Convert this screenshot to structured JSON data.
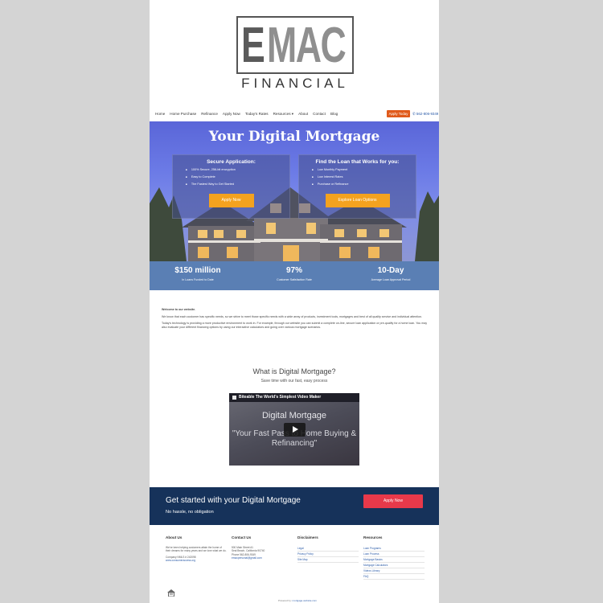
{
  "logo": {
    "e": "E",
    "mac": "MAC",
    "financial": "FINANCIAL"
  },
  "nav": {
    "items": [
      "Home",
      "Home Purchase",
      "Refinance",
      "Apply Now",
      "Today's Rates",
      "Resources ▾",
      "About",
      "Contact",
      "Blog"
    ],
    "apply_today": "Apply Today",
    "phone": "562-806-9349"
  },
  "hero": {
    "title": "Your Digital Mortgage",
    "left_panel": {
      "title": "Secure Application:",
      "items": [
        "100% Secure, 256-bit encryption",
        "Easy to Complete",
        "The Fastest Way to Get Started"
      ],
      "button": "Apply Now"
    },
    "right_panel": {
      "title": "Find the Loan that Works for you:",
      "items": [
        "Low Monthly Payment",
        "Low Interest Rates",
        "Purchase or Refinance"
      ],
      "button": "Explore Loan Options"
    }
  },
  "stats": [
    {
      "value": "$150 million",
      "label": "In Loans Funded to Date"
    },
    {
      "value": "97%",
      "label": "Customer Satisfaction Rate"
    },
    {
      "value": "10-Day",
      "label": "Average Loan Approval Period"
    }
  ],
  "welcome": {
    "title": "Welcome to our website.",
    "p1": "We know that each customer has specific needs, so we strive to meet those specific needs with a wide array of products, investment tools, mortgages and best of all quality service and individual attention.",
    "p2": "Today's technology is providing a more productive environment to work in. For example, through our website you can submit a complete on-line, secure loan application or pre-qualify for a home loan. You may also evaluate your different financing options by using our interactive calculators and going over various mortgage scenarios."
  },
  "what": {
    "title": "What is Digital Mortgage?",
    "subtitle": "Save time with our fast, easy process",
    "video": {
      "brand": "Biteable",
      "brand_text": "The World's Simplest Video Maker",
      "title": "Digital Mortgage",
      "subtitle": "\"Your Fast Pass to Home Buying & Refinancing\""
    }
  },
  "cta": {
    "title": "Get started with your Digital Mortgage",
    "subtitle": "No hassle, no obligation",
    "button": "Apply Now"
  },
  "footer": {
    "about": {
      "title": "About Us",
      "text": "We've been helping customers attain the home of their dreams for many years and we love what we do.",
      "nmls": "Company NMLS # 242098",
      "link": "www.consumeraccess.org"
    },
    "contact": {
      "title": "Contact Us",
      "address1": "500 Main Street #1",
      "address2": "Seal Beach, California 90740",
      "phone": "Phone 562-806-9349",
      "email": "emacpersonal@gmail.com"
    },
    "disclaimers": {
      "title": "Disclaimers",
      "links": [
        "Legal",
        "Privacy Policy",
        "Site Map"
      ]
    },
    "resources": {
      "title": "Resources",
      "links": [
        "Loan Programs",
        "Loan Process",
        "Mortgage Basics",
        "Mortgage Calculators",
        "Videos Library",
        "FAQ"
      ]
    },
    "powered_prefix": "Powered by:",
    "powered_link": "mortgage-website.com"
  },
  "colors": {
    "orange_button": "#f4a21f",
    "apply_today": "#e05a1b",
    "stats_bar": "#5a7fb4",
    "cta_bg": "#16325a",
    "cta_button": "#e8394a",
    "link": "#2b5ba8"
  }
}
